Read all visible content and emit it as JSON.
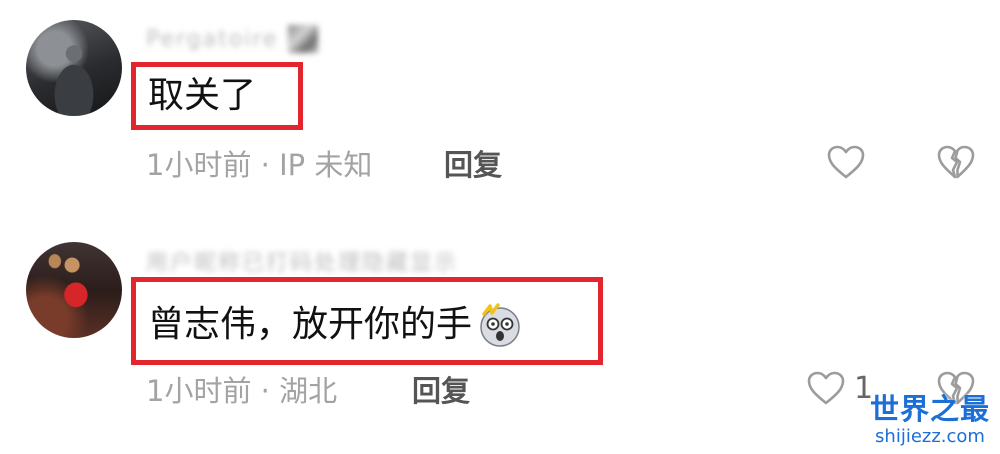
{
  "comments": [
    {
      "username": "Pergatoire",
      "text": "取关了",
      "meta": "1小时前 · IP 未知",
      "reply_label": "回复",
      "like_count": "",
      "avatar_icon": "avatar-photo"
    },
    {
      "username": "用户昵称已打码处理隐藏显示",
      "text": "曾志伟，放开你的手",
      "emoji_icon": "shocked-face-icon",
      "meta": "1小时前 · 湖北",
      "reply_label": "回复",
      "like_count": "1",
      "avatar_icon": "avatar-photo"
    }
  ],
  "watermark": {
    "title": "世界之最",
    "url": "shijiezz.com"
  },
  "colors": {
    "highlight": "#e3262d",
    "meta_text": "#a3a3a3",
    "watermark": "#1c6fd6"
  }
}
